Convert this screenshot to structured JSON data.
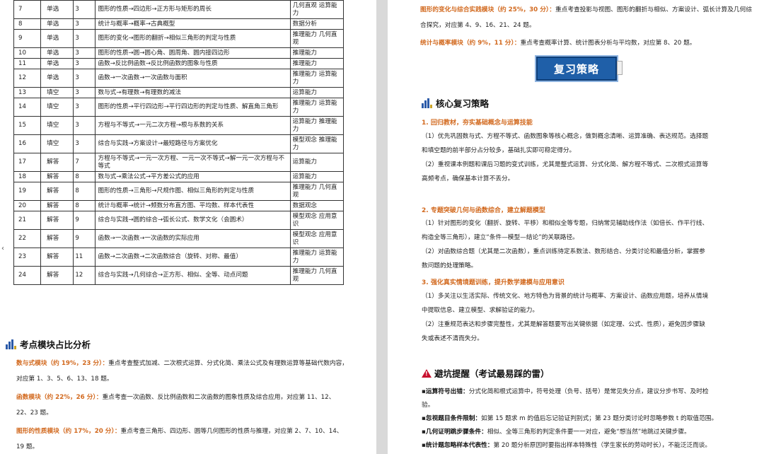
{
  "exam_table": {
    "rows": [
      {
        "no": "7",
        "type": "单选",
        "score": "3",
        "content": "图形的性质→四边形→正方形与矩形的周长",
        "ability": "几何直观 运算能力"
      },
      {
        "no": "8",
        "type": "单选",
        "score": "3",
        "content": "统计与概率→概率→古典概型",
        "ability": "数据分析"
      },
      {
        "no": "9",
        "type": "单选",
        "score": "3",
        "content": "图形的变化→图形的翻折→相似三角形的判定与性质",
        "ability": "推理能力 几何直观"
      },
      {
        "no": "10",
        "type": "单选",
        "score": "3",
        "content": "图形的性质→圆→圆心角、圆周角、圆内接四边形",
        "ability": "推理能力"
      },
      {
        "no": "11",
        "type": "单选",
        "score": "3",
        "content": "函数→反比例函数→反比例函数的图象与性质",
        "ability": "推理能力"
      },
      {
        "no": "12",
        "type": "单选",
        "score": "3",
        "content": "函数→一次函数→一次函数与面积",
        "ability": "推理能力 运算能力"
      },
      {
        "no": "13",
        "type": "填空",
        "score": "3",
        "content": "数与式→有理数→有理数的减法",
        "ability": "运算能力"
      },
      {
        "no": "14",
        "type": "填空",
        "score": "3",
        "content": "图形的性质→平行四边形→平行四边形的判定与性质、解直角三角形",
        "ability": "推理能力 运算能力"
      },
      {
        "no": "15",
        "type": "填空",
        "score": "3",
        "content": "方程与不等式→一元二次方程→根与系数的关系",
        "ability": "运算能力 推理能力"
      },
      {
        "no": "16",
        "type": "填空",
        "score": "3",
        "content": "综合与实践→方案设计→最短路径与方案优化",
        "ability": "模型观念 推理能力"
      },
      {
        "no": "17",
        "type": "解答",
        "score": "7",
        "content": "方程与不等式→一元一次方程、一元一次不等式→解一元一次方程与不等式",
        "ability": "运算能力"
      },
      {
        "no": "18",
        "type": "解答",
        "score": "8",
        "content": "数与式→乘法公式→平方差公式的应用",
        "ability": "运算能力"
      },
      {
        "no": "19",
        "type": "解答",
        "score": "8",
        "content": "图形的性质→三角形→尺规作图、相似三角形的判定与性质",
        "ability": "推理能力 几何直观"
      },
      {
        "no": "20",
        "type": "解答",
        "score": "8",
        "content": "统计与概率→统计→频数分布直方图、平均数、样本代表性",
        "ability": "数据观念"
      },
      {
        "no": "21",
        "type": "解答",
        "score": "9",
        "content": "综合与实践→圆的综合→弧长公式、数学文化（会圆术）",
        "ability": "模型观念 应用意识"
      },
      {
        "no": "22",
        "type": "解答",
        "score": "9",
        "content": "函数→一次函数→一次函数的实际应用",
        "ability": "模型观念 应用意识"
      },
      {
        "no": "23",
        "type": "解答",
        "score": "11",
        "content": "函数→二次函数→二次函数综合（旋转、对称、最值）",
        "ability": "推理能力 运算能力"
      },
      {
        "no": "24",
        "type": "解答",
        "score": "12",
        "content": "综合与实践→几何综合→正方形、相似、全等、动点问题",
        "ability": "推理能力 几何直观"
      }
    ]
  },
  "module_section": {
    "title": "考点模块占比分析",
    "modules": [
      {
        "lead": "数与式模块（约 19%，23 分）：",
        "text": "重点考查整式加减、二次根式运算、分式化简、乘法公式及有理数运算等基础代数内容，对应第 1、3、5、6、13、18 题。"
      },
      {
        "lead": "函数模块（约 22%，26 分）：",
        "text": "重点考查一次函数、反比例函数和二次函数的图象性质及综合应用，对应第 11、12、22、23 题。"
      },
      {
        "lead": "图形的性质模块（约 17%，20 分）：",
        "text": "重点考查三角形、四边形、圆等几何图形的性质与推理，对应第 2、7、10、14、19 题。"
      }
    ]
  },
  "right_top": [
    {
      "lead": "图形的变化与综合实践模块（约 25%，30 分）：",
      "text": "重点考查投影与视图、图形的翻折与相似、方案设计、弧长计算及几何综合探究，对应第 4、9、16、21、24 题。"
    },
    {
      "lead": "统计与概率模块（约 9%，11 分）：",
      "text": "重点考查概率计算、统计图表分析与平均数，对应第 8、20 题。"
    }
  ],
  "banner": "复习策略",
  "strategy": {
    "title": "核心复习策略",
    "items": [
      {
        "heading": "1. 回归教材，夯实基础概念与运算技能",
        "lines": [
          "（1）优先巩固数与式、方程不等式、函数图象等核心概念，做到概念清晰、运算准确、表达规范。选择题",
          "和填空题的前半部分占分较多，基础扎实即可稳定得分。",
          "（2）重视课本例题和课后习题的变式训练，尤其是整式运算、分式化简、解方程不等式、二次根式运算等",
          "高频考点，确保基本计算不丢分。"
        ]
      },
      {
        "heading": "2. 专题突破几何与函数综合，建立解题模型",
        "lines": [
          "（1）针对图形的变化（翻折、旋转、平移）和相似全等专题，归纳常见辅助线作法（如倍长、作平行线、",
          "构造全等三角形），建立“条件—模型—结论”的关联路径。",
          "（2）对函数综合题（尤其是二次函数），重点训练待定系数法、数形结合、分类讨论和最值分析，掌握参",
          "数问题的处理策略。"
        ]
      },
      {
        "heading": "3. 强化真实情境题训练，提升数学建模与应用意识",
        "lines": [
          "（1）多关注以生活实际、传统文化、地方特色为背景的统计与概率、方案设计、函数应用题，培养从情境",
          "中提取信息、建立模型、求解验证的能力。",
          "（2）注重规范表达和步骤完整性，尤其是解答题要写出关键依据（如定理、公式、性质），避免因步骤缺",
          "失或表述不清而失分。"
        ]
      }
    ]
  },
  "pitfalls": {
    "title": "避坑提醒（考试最易踩的雷）",
    "items": [
      {
        "lead": "运算符号出错：",
        "text": "分式化简和根式运算中，符号处理（负号、括号）是常见失分点，建议分步书写、及时检",
        "cont": "验。"
      },
      {
        "lead": "忽视题目条件限制：",
        "text": "如第 15 题求 m 的值后忘记验证判别式；第 23 题分类讨论时忽略参数 t 的取值范围。",
        "cont": ""
      },
      {
        "lead": "几何证明跳步骤条件：",
        "text": "相似、全等三角形的判定条件要一一对应，避免“想当然”地跳过关键步骤。",
        "cont": ""
      },
      {
        "lead": "统计题忽略样本代表性：",
        "text": "第 20 题分析原因时要指出样本特殊性（学生家长的劳动时长），不能泛泛而谈。",
        "cont": ""
      }
    ]
  }
}
